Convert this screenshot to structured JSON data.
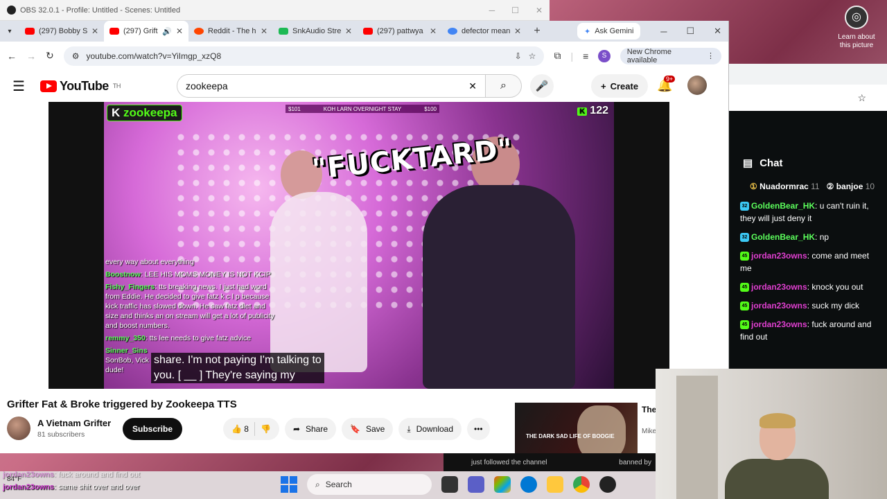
{
  "obs": {
    "title": "OBS 32.0.1 - Profile: Untitled - Scenes: Untitled"
  },
  "gemini_lens": {
    "label": "Learn about this picture"
  },
  "tabs": [
    {
      "label": "(297) Bobby S",
      "color": "#ff0000"
    },
    {
      "label": "(297) Grift",
      "color": "#ff0000"
    },
    {
      "label": "Reddit - The h",
      "color": "#ff4500"
    },
    {
      "label": "SnkAudio Stre",
      "color": "#1db954"
    },
    {
      "label": "(297) pattwya",
      "color": "#ff0000"
    },
    {
      "label": "defector mean",
      "color": "#4285f4"
    }
  ],
  "chrome": {
    "ask_gemini": "Ask Gemini",
    "url": "youtube.com/watch?v=YiImgp_xzQ8",
    "profile_initial": "S",
    "new_chrome": "New Chrome available"
  },
  "youtube": {
    "logo": "YouTube",
    "country": "TH",
    "search_value": "zookeepa",
    "create": "Create",
    "notif_count": "9+"
  },
  "video": {
    "kick_name": "zookeepa",
    "goal_left": "$101",
    "goal_text": "KOH LARN OVERNIGHT STAY",
    "goal_right": "$100",
    "viewers": "122",
    "overlay_word": "\"FUCKTARD\"",
    "chat": [
      {
        "user": "",
        "text": "every way about everything"
      },
      {
        "user": "Boostnow",
        "text": ": LEE HIS MOMS MONEY IS NOT KCIP"
      },
      {
        "user": "Fishy_Fingers",
        "text": ": tts breaking news. I just had word from Eddie. He decided to give fatz k c l p because kick traffic has slowed down. He saw fatz diet and size and thinks an on stream will get a lot of publicity and boost numbers."
      },
      {
        "user": "remmy_350",
        "text": ": tts lee needs to give fatz advice"
      },
      {
        "user": "Sinner_Sins",
        "text": ""
      },
      {
        "user": "",
        "text": "SonBob, Vick"
      },
      {
        "user": "",
        "text": "dude!"
      }
    ],
    "caption_1": "share. I'm not paying I'm talking to",
    "caption_2": "you. [ __ ] They're saying my"
  },
  "info": {
    "title": "Grifter Fat & Broke triggered by Zookeepa TTS",
    "channel": "A Vietnam Grifter",
    "subscribers": "81 subscribers",
    "subscribe": "Subscribe",
    "likes": "8",
    "share": "Share",
    "save": "Save",
    "download": "Download"
  },
  "recommendation": {
    "thumb_text": "THE DARK SAD LIFE OF BOOGIE",
    "title": "The of B",
    "meta": "Mike"
  },
  "kick_chat": {
    "header": "Chat",
    "pinned": [
      {
        "user": "Nuadormrac",
        "rank": "11"
      },
      {
        "user": "banjoe",
        "rank": "10"
      }
    ],
    "messages": [
      {
        "badge": "32",
        "user": "GoldenBear_HK",
        "text": ": u can't ruin it, they will just deny it",
        "color": "#5cff5c"
      },
      {
        "badge": "32",
        "user": "GoldenBear_HK",
        "text": ": np",
        "color": "#5cff5c"
      },
      {
        "badge": "45",
        "user": "jordan23owns",
        "text": ": come and meet me",
        "color": "#e03fd0"
      },
      {
        "badge": "45",
        "user": "jordan23owns",
        "text": ": knock you out",
        "color": "#e03fd0"
      },
      {
        "badge": "45",
        "user": "jordan23owns",
        "text": ": suck my dick",
        "color": "#e03fd0"
      },
      {
        "badge": "45",
        "user": "jordan23owns",
        "text": ": fuck around and find out",
        "color": "#e03fd0"
      }
    ],
    "strip_left": "just followed the channel",
    "strip_right": "banned by"
  },
  "taskbar": {
    "weather": "84°F",
    "search": "Search"
  },
  "bottom_chat": [
    {
      "user": "jordan23owns",
      "text": ": fuck around and find out"
    },
    {
      "user": "jordan23owns",
      "text": ": same shit over and over"
    }
  ]
}
